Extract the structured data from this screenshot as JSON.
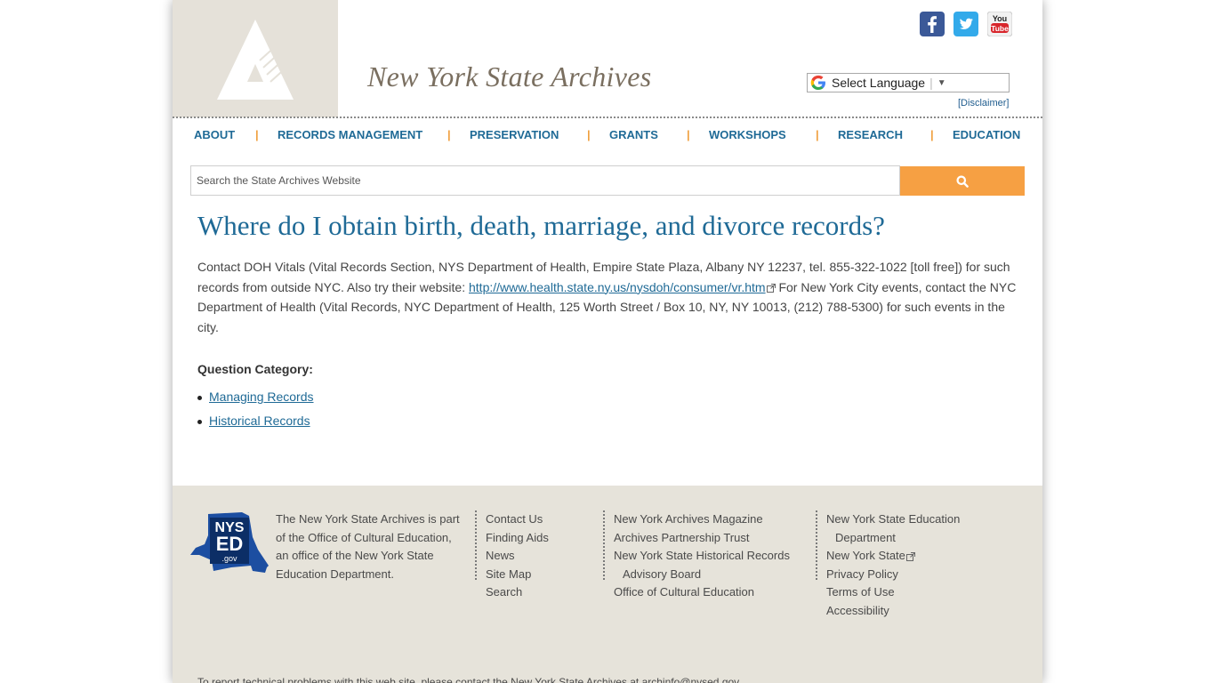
{
  "header": {
    "site_title": "New York State Archives",
    "language_select": "Select Language",
    "disclaimer": "[Disclaimer]",
    "social": [
      "facebook-icon",
      "twitter-icon",
      "youtube-icon"
    ],
    "youtube_label_top": "You",
    "youtube_label_bottom": "Tube"
  },
  "nav": {
    "about": "ABOUT",
    "records_management": "RECORDS MANAGEMENT",
    "preservation": "PRESERVATION",
    "grants": "GRANTS",
    "workshops": "WORKSHOPS",
    "research": "RESEARCH",
    "education": "EDUCATION",
    "separator": "|"
  },
  "search": {
    "placeholder": "Search the State Archives Website"
  },
  "main": {
    "heading": "Where do I obtain birth, death, marriage, and divorce records?",
    "text_part1": "Contact DOH Vitals (Vital Records Section, NYS Department of Health, Empire State Plaza, Albany NY 12237, tel. 855-322-1022 [toll free]) for such records from outside NYC. Also try their website: ",
    "link_url": "http://www.health.state.ny.us/nysdoh/consumer/vr.htm",
    "text_part2": " For New York City events, contact the NYC Department of Health (Vital Records, NYC Department of Health, 125 Worth Street / Box 10, NY, NY 10013, (212) 788-5300) for such events in the city.",
    "category_label": "Question Category:",
    "categories": [
      "Managing Records",
      "Historical Records"
    ]
  },
  "footer": {
    "logo_top": "NYS",
    "logo_mid": "ED",
    "logo_bottom": ".gov",
    "about": "The New York State Archives is part of the Office of Cultural Education, an office of the New York State Education Department.",
    "col1": [
      "Contact Us",
      "Finding Aids",
      "News",
      "Site Map",
      "Search"
    ],
    "col2": [
      "New York Archives Magazine",
      "Archives Partnership Trust",
      "New York State Historical Records",
      "Advisory Board",
      "Office of Cultural Education"
    ],
    "col3": [
      "New York State Education",
      "Department",
      "New York State",
      "Privacy Policy",
      "Terms of Use",
      "Accessibility"
    ],
    "bottom_text": "To report technical problems with this web site, please contact the New York State Archives at archinfo@nysed.gov"
  },
  "colors": {
    "link_blue": "#1f6a96",
    "accent_orange": "#f6a043",
    "logo_beige": "#e5e1d9",
    "footer_bg": "#e6e3da"
  }
}
